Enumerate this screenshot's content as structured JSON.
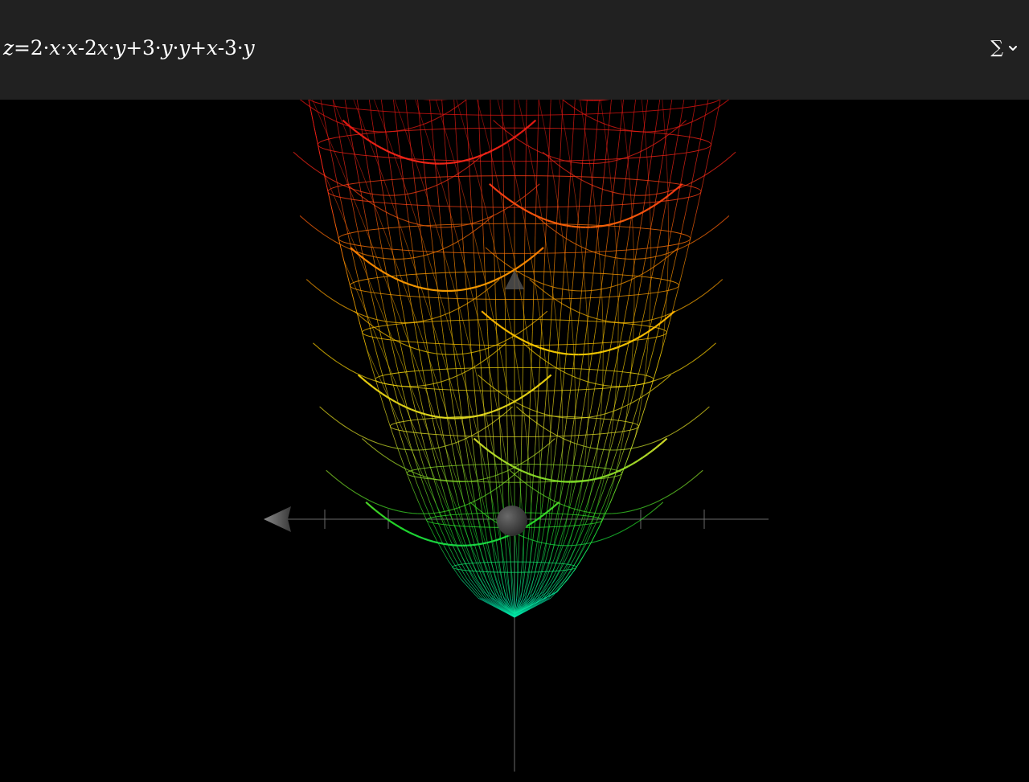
{
  "toolbar": {
    "equation": {
      "lhs": "z",
      "eq": "=",
      "parts": [
        {
          "t": "2·",
          "i": false
        },
        {
          "t": "x",
          "i": true
        },
        {
          "t": "·",
          "i": false
        },
        {
          "t": "x",
          "i": true
        },
        {
          "t": "-2",
          "i": false
        },
        {
          "t": "x",
          "i": true
        },
        {
          "t": "·",
          "i": false
        },
        {
          "t": "y",
          "i": true
        },
        {
          "t": "+3·",
          "i": false
        },
        {
          "t": "y",
          "i": true
        },
        {
          "t": "·",
          "i": false
        },
        {
          "t": "y",
          "i": true
        },
        {
          "t": "+",
          "i": false
        },
        {
          "t": "x",
          "i": true
        },
        {
          "t": "-3·",
          "i": false
        },
        {
          "t": "y",
          "i": true
        }
      ]
    },
    "menu_glyph": "∑",
    "menu_icon": "chevron-down-icon"
  },
  "surface": {
    "function": "z=2·x·x-2x·y+3·y·y+x-3·y",
    "render": "wireframe",
    "color_gradient": [
      "#00e5b0",
      "#22e02a",
      "#dfe22a",
      "#ffd000",
      "#ff8a00",
      "#ff2a1a",
      "#e01010"
    ]
  },
  "axes": {
    "color": "#6a6a6a",
    "arrow_color": "#555555"
  }
}
